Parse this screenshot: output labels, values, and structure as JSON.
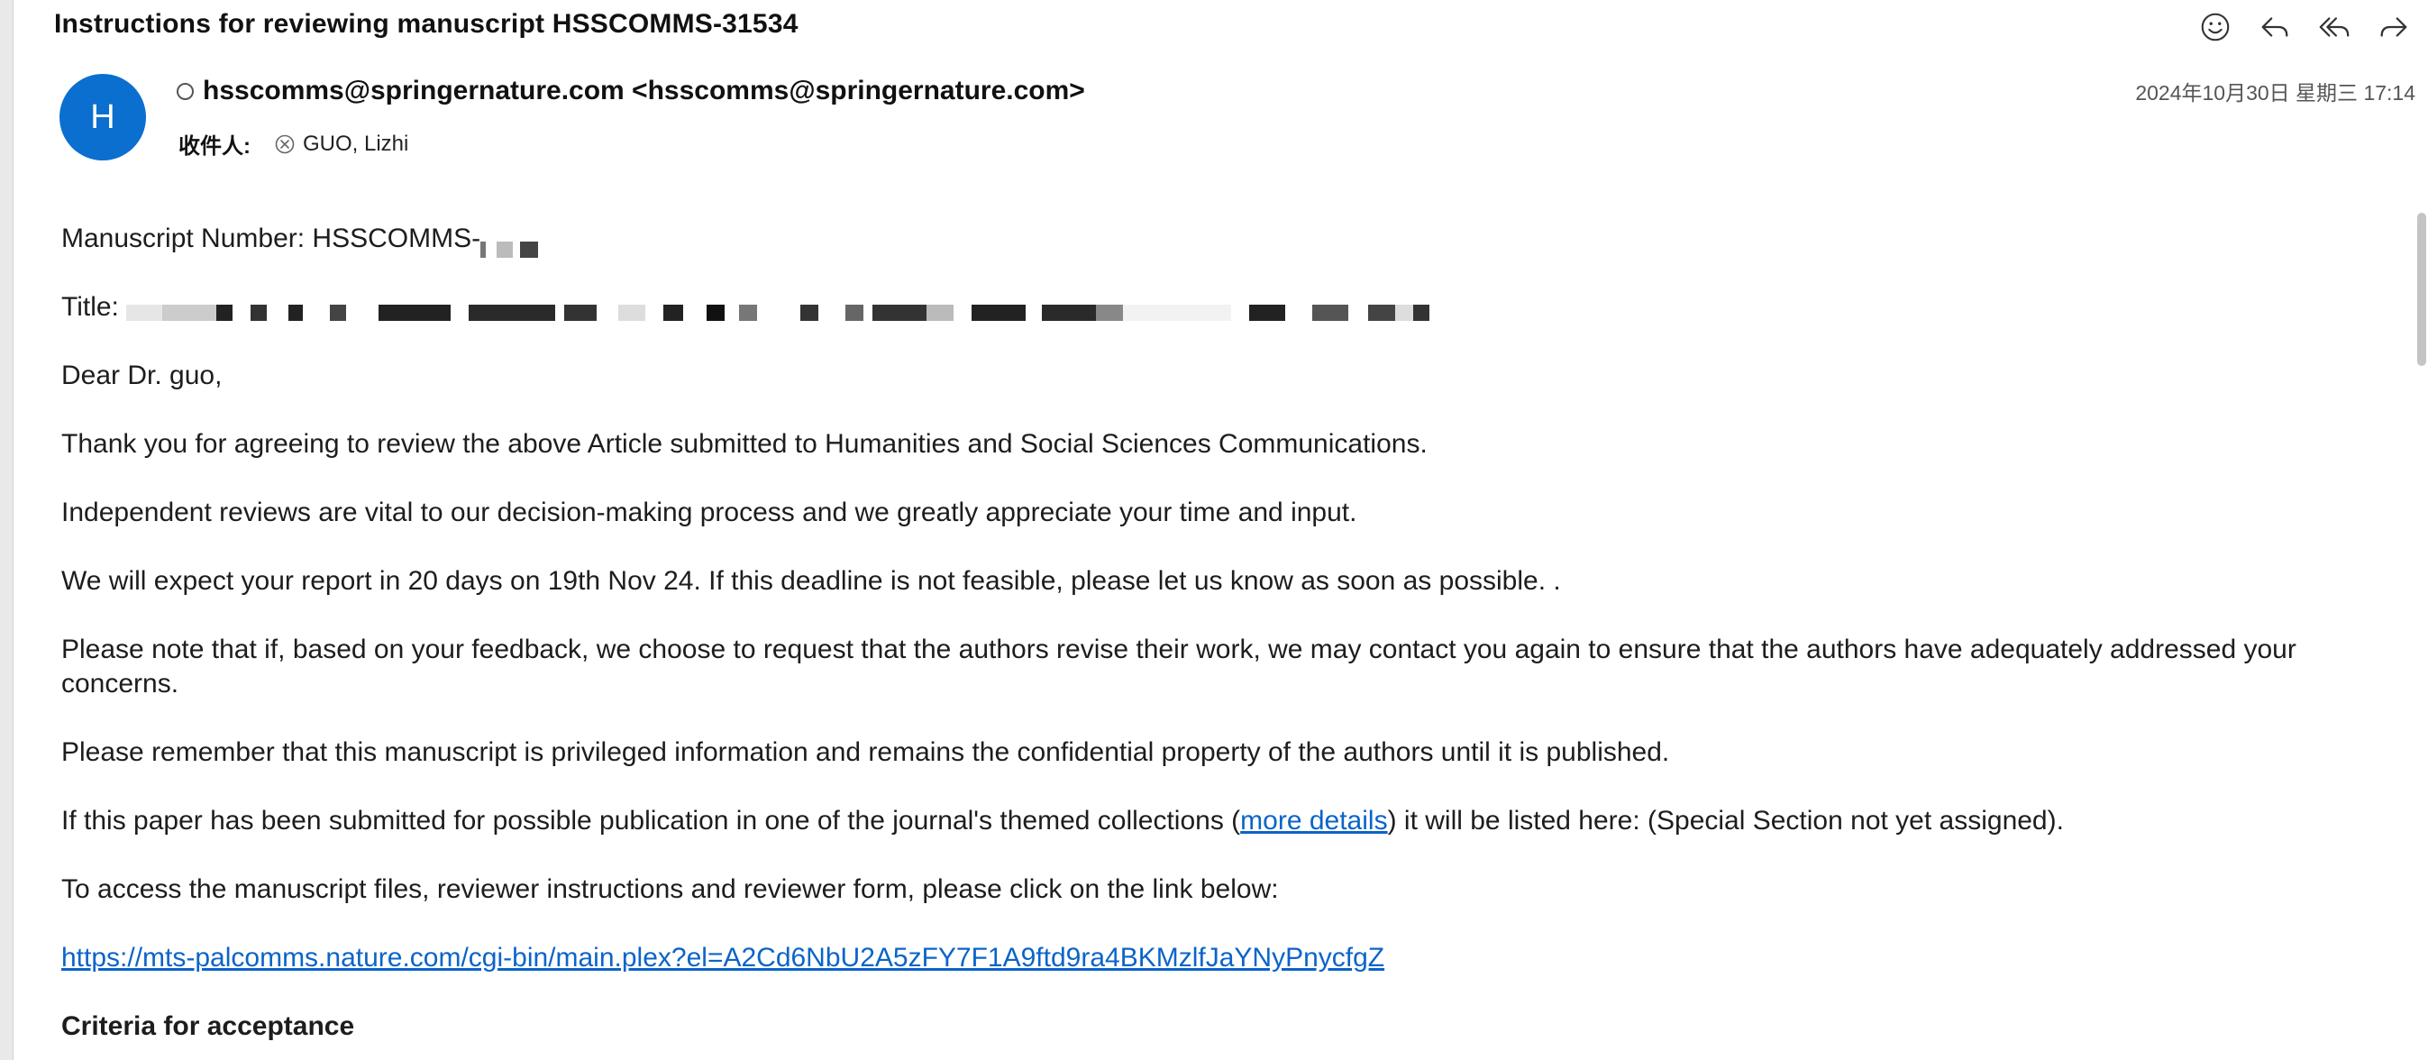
{
  "message": {
    "subject": "Instructions for reviewing manuscript HSSCOMMS-31534",
    "avatar_letter": "H",
    "from": "hsscomms@springernature.com <hsscomms@springernature.com>",
    "to_label": "收件人:",
    "recipient": "GUO, Lizhi",
    "date": "2024年10月30日 星期三 17:14"
  },
  "toolbar": {
    "icons": [
      "emoji-icon",
      "reply-icon",
      "reply-all-icon",
      "forward-icon"
    ]
  },
  "body": {
    "manuscript_label": "Manuscript Number: HSSCOMMS-",
    "title_label": "Title:",
    "greeting": "Dear Dr. guo,",
    "p1": "Thank you for agreeing to review the above Article submitted to Humanities and Social Sciences Communications.",
    "p2": "Independent reviews are vital to our decision-making process and we greatly appreciate your time and input.",
    "p3": "We will expect your report in 20 days on 19th Nov 24. If this deadline is not feasible, please let us know as soon as possible. .",
    "p4": "Please note that if, based on your feedback, we choose to request that the authors revise their work, we may contact you again to ensure that the authors have adequately addressed your concerns.",
    "p5": "Please remember that this manuscript is privileged information and remains the confidential property of the authors until it is published.",
    "p6_before": "If this paper has been submitted for possible publication in one of the journal's themed collections (",
    "p6_link": "more details",
    "p6_after": ") it will be listed here: (Special Section not yet assigned).",
    "p7": "To access the manuscript files, reviewer instructions and reviewer form, please click on the link below:",
    "link_url": "https://mts-palcomms.nature.com/cgi-bin/main.plex?el=A2Cd6NbU2A5zFY7F1A9ftd9ra4BKMzlfJaYNyPnycfgZ",
    "section_heading": "Criteria for acceptance"
  },
  "colors": {
    "accent": "#0b6fcf",
    "link": "#0b64c8"
  }
}
